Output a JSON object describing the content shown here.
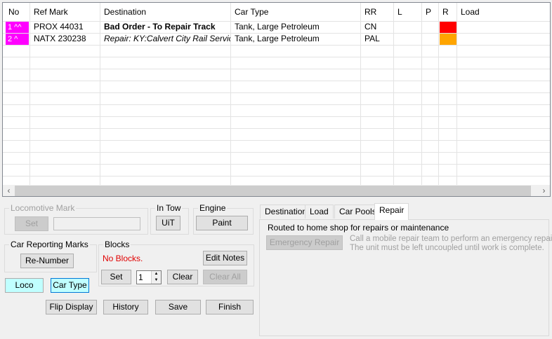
{
  "grid": {
    "headers": [
      "No",
      "Ref Mark",
      "Destination",
      "Car Type",
      "RR",
      "L",
      "P",
      "R",
      "Load"
    ],
    "rows": [
      {
        "no": "1 ^^",
        "ref": "PROX 44031",
        "dest": "Bad Order - To Repair Track",
        "dest_style": "bold",
        "type": "Tank, Large Petroleum",
        "rr": "CN",
        "status_color": "#ff0000"
      },
      {
        "no": "2 ^",
        "ref": "NATX 230238",
        "dest": "Repair: KY:Calvert City Rail Servic...",
        "dest_style": "italic",
        "type": "Tank, Large Petroleum",
        "rr": "PAL",
        "status_color": "#ffa500"
      }
    ],
    "scroll_left_icon": "chevron-left-icon",
    "scroll_right_icon": "chevron-right-icon"
  },
  "locomotive_mark": {
    "title": "Locomotive Mark",
    "set_label": "Set",
    "value": ""
  },
  "in_tow": {
    "title": "In Tow",
    "button_label": "UiT"
  },
  "engine": {
    "title": "Engine",
    "button_label": "Paint"
  },
  "car_reporting_marks": {
    "title": "Car Reporting Marks",
    "button_label": "Re-Number"
  },
  "blocks": {
    "title": "Blocks",
    "status": "No Blocks.",
    "edit_notes_label": "Edit Notes",
    "set_label": "Set",
    "spinner_value": "1",
    "clear_label": "Clear",
    "clear_all_label": "Clear All"
  },
  "toggles": {
    "loco_label": "Loco",
    "car_type_label": "Car Type"
  },
  "bottom_buttons": {
    "flip_display": "Flip Display",
    "history": "History",
    "save": "Save",
    "finish": "Finish"
  },
  "tabs": [
    "Destination",
    "Load",
    "Car Pools",
    "Repair"
  ],
  "active_tab": "Repair",
  "repair": {
    "heading": "Routed to home shop for repairs or maintenance",
    "emergency_button": "Emergency Repair",
    "description_line1": "Call a mobile repair team to perform an emergency repair.",
    "description_line2": "The unit must be left uncoupled until work is complete."
  },
  "colors": {
    "magenta": "#ff00ff",
    "cyan": "#c0ffff",
    "red_status": "#ff0000",
    "orange_status": "#ffa500",
    "warning_text": "#e00000"
  }
}
